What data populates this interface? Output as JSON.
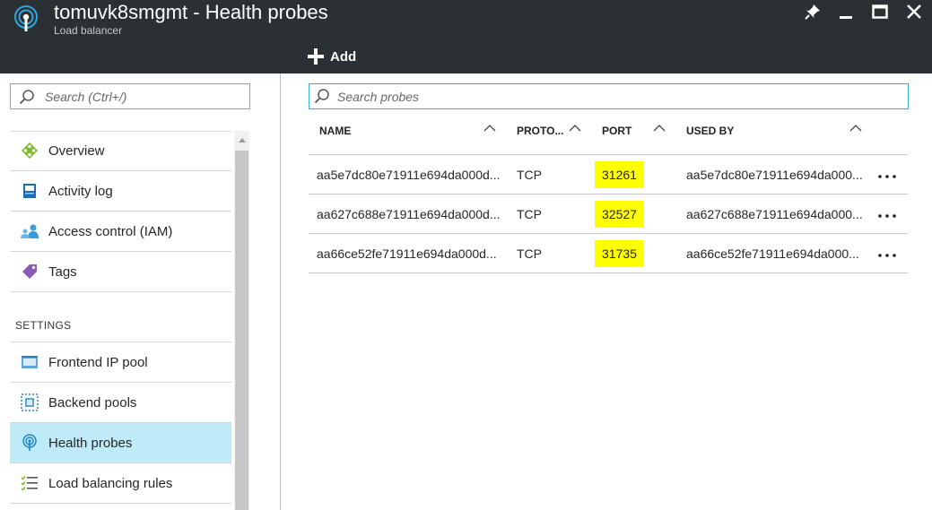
{
  "window": {
    "title": "tomuvk8smgmt - Health probes",
    "subtitle": "Load balancer",
    "controls": [
      "pin",
      "minimize",
      "maximize",
      "close"
    ]
  },
  "toolbar": {
    "add_label": "Add"
  },
  "left_panel": {
    "search_placeholder": "Search (Ctrl+/)",
    "items": [
      {
        "label": "Overview",
        "icon": "overview-icon"
      },
      {
        "label": "Activity log",
        "icon": "activity-log-icon"
      },
      {
        "label": "Access control (IAM)",
        "icon": "iam-icon"
      },
      {
        "label": "Tags",
        "icon": "tag-icon"
      }
    ],
    "settings_header": "SETTINGS",
    "settings_items": [
      {
        "label": "Frontend IP pool",
        "icon": "frontend-ip-icon"
      },
      {
        "label": "Backend pools",
        "icon": "backend-pool-icon"
      },
      {
        "label": "Health probes",
        "icon": "health-probe-icon",
        "active": true
      },
      {
        "label": "Load balancing rules",
        "icon": "rules-list-icon"
      }
    ]
  },
  "probes": {
    "search_placeholder": "Search probes",
    "columns": {
      "name": "NAME",
      "protocol": "PROTO...",
      "port": "PORT",
      "used_by": "USED BY"
    },
    "rows": [
      {
        "name": "aa5e7dc80e71911e694da000d...",
        "protocol": "TCP",
        "port": "31261",
        "used_by": "aa5e7dc80e71911e694da000..."
      },
      {
        "name": "aa627c688e71911e694da000d...",
        "protocol": "TCP",
        "port": "32527",
        "used_by": "aa627c688e71911e694da000..."
      },
      {
        "name": "aa66ce52fe71911e694da000d...",
        "protocol": "TCP",
        "port": "31735",
        "used_by": "aa66ce52fe71911e694da000..."
      }
    ],
    "more_label": "...",
    "highlight_color": "#ffff00"
  },
  "colors": {
    "titlebar": "#2b3035",
    "active_item": "#bfeaf8",
    "search_focus_border": "#35b5c8"
  }
}
